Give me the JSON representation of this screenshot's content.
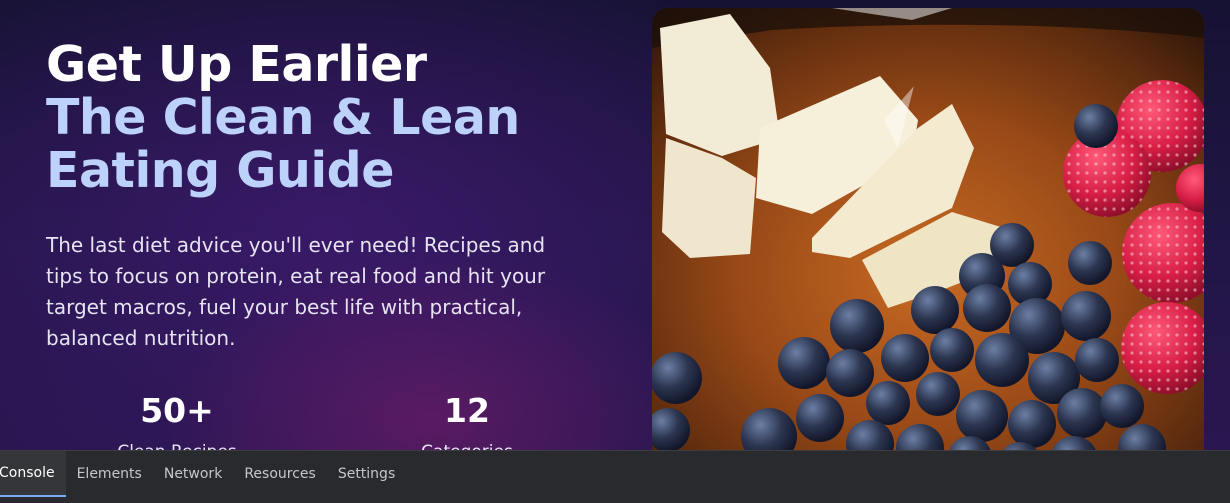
{
  "hero": {
    "title_line1": "Get Up Earlier",
    "title_line2": "The Clean & Lean",
    "title_line3": "Eating Guide",
    "description": "The last diet advice you'll ever need! Recipes and tips to focus on protein, eat real food and hit your target macros, fuel your best life with practical, balanced nutrition.",
    "stats": [
      {
        "value": "50+",
        "label": "Clean Recipes"
      },
      {
        "value": "12",
        "label": "Categories"
      }
    ],
    "photo_subject": "white cheese slices, blueberries and raspberries on a brown plate"
  },
  "devtools": {
    "tabs": [
      "Console",
      "Elements",
      "Network",
      "Resources",
      "Settings"
    ],
    "active_tab": "Console"
  },
  "colors": {
    "title_white": "#ffffff",
    "title_accent": "#bcd2fb",
    "background": "#1e1540",
    "devtools_bg": "#292a2d",
    "active_tab_underline": "#7cacf8"
  }
}
